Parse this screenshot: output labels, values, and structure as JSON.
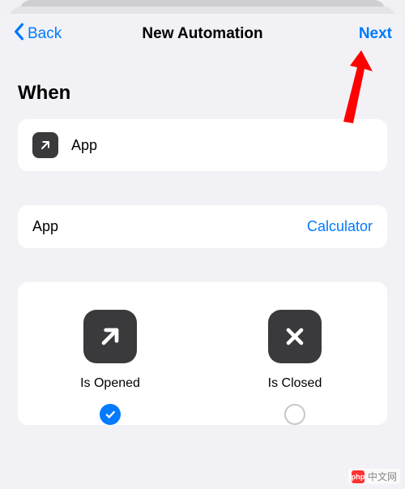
{
  "nav": {
    "back_label": "Back",
    "title": "New Automation",
    "next_label": "Next"
  },
  "section_title": "When",
  "trigger_card": {
    "label": "App"
  },
  "app_select": {
    "label": "App",
    "value": "Calculator"
  },
  "options": {
    "opened": {
      "label": "Is Opened",
      "selected": true
    },
    "closed": {
      "label": "Is Closed",
      "selected": false
    }
  },
  "watermark": "中文网",
  "watermark_logo": "php"
}
